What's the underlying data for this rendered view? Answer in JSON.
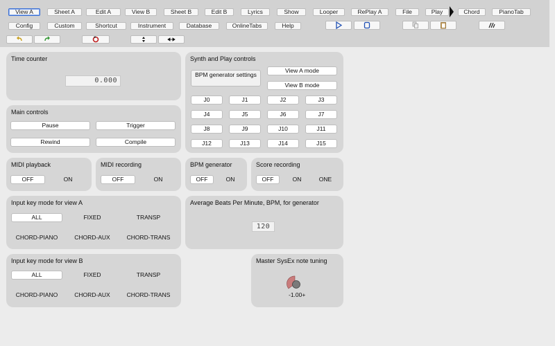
{
  "toolbar": {
    "row1": [
      "View A",
      "Sheet A",
      "Edit A",
      "View B",
      "Sheet B",
      "Edit B",
      "Lyrics",
      "Show",
      "Looper",
      "RePlay A",
      "File",
      "Play",
      "Chord",
      "PianoTab"
    ],
    "row2": [
      "Config",
      "Custom",
      "Shortcut",
      "Instrument",
      "Database",
      "OnlineTabs",
      "Help"
    ],
    "selected": "View A",
    "icons": {
      "play": "play-icon",
      "stop": "stop-icon",
      "copy": "copy-icon",
      "paste": "paste-icon",
      "tuning": "tuning-fork-icon",
      "undo": "undo-icon",
      "redo": "redo-icon",
      "reset": "reset-icon",
      "vertical": "vertical-arrows-icon",
      "horizontal": "horizontal-arrows-icon"
    }
  },
  "time_counter": {
    "title": "Time counter",
    "value": "0.000"
  },
  "main_controls": {
    "title": "Main controls",
    "buttons": [
      "Pause",
      "Trigger",
      "Rewind",
      "Compile"
    ]
  },
  "synth": {
    "title": "Synth and Play controls",
    "bpm_settings": "BPM generator settings",
    "view_a_mode": "View A mode",
    "view_b_mode": "View B mode",
    "jumps": [
      "J0",
      "J1",
      "J2",
      "J3",
      "J4",
      "J5",
      "J6",
      "J7",
      "J8",
      "J9",
      "J10",
      "J11",
      "J12",
      "J13",
      "J14",
      "J15"
    ]
  },
  "midi_playback": {
    "title": "MIDI playback",
    "options": [
      "OFF",
      "ON"
    ],
    "selected": "OFF"
  },
  "midi_recording": {
    "title": "MIDI recording",
    "options": [
      "OFF",
      "ON"
    ],
    "selected": "OFF"
  },
  "bpm_generator": {
    "title": "BPM generator",
    "options": [
      "OFF",
      "ON"
    ],
    "selected": "OFF"
  },
  "score_recording": {
    "title": "Score recording",
    "options": [
      "OFF",
      "ON",
      "ONE"
    ],
    "selected": "OFF"
  },
  "input_key_a": {
    "title": "Input key mode for view A",
    "options": [
      "ALL",
      "FIXED",
      "TRANSP",
      "CHORD-PIANO",
      "CHORD-AUX",
      "CHORD-TRANS"
    ],
    "selected": "ALL"
  },
  "avg_bpm": {
    "title": "Average Beats Per Minute, BPM, for generator",
    "value": "120"
  },
  "input_key_b": {
    "title": "Input key mode for view B",
    "options": [
      "ALL",
      "FIXED",
      "TRANSP",
      "CHORD-PIANO",
      "CHORD-AUX",
      "CHORD-TRANS"
    ],
    "selected": "ALL"
  },
  "sysex": {
    "title": "Master SysEx note tuning",
    "value": "-1.00+"
  },
  "colors": {
    "panel": "#d6d6d6",
    "toolbar": "#d2d2d2",
    "knob": "#c97c7c",
    "selected_border": "#3b6fd4"
  }
}
